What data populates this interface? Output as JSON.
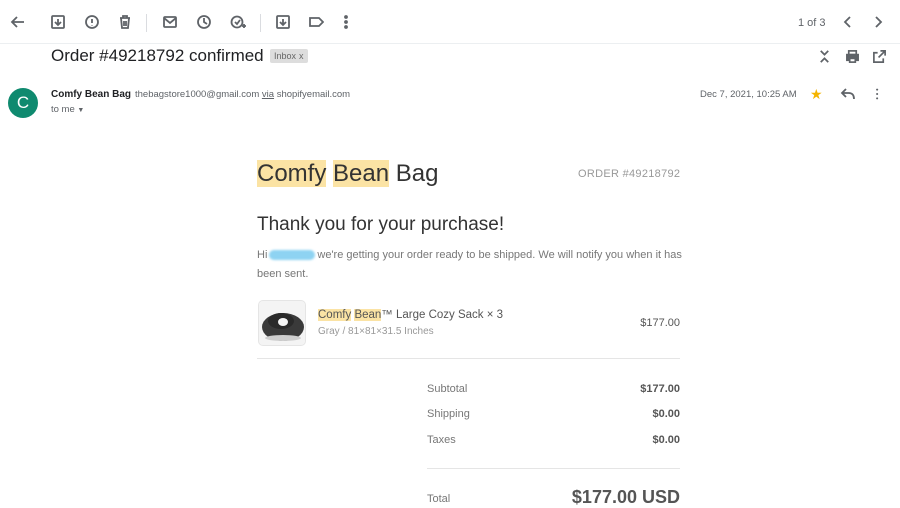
{
  "toolbar": {
    "icons": [
      "back-arrow-icon",
      "archive-icon",
      "report-spam-icon",
      "delete-icon",
      "mark-unread-icon",
      "snooze-icon",
      "add-task-icon",
      "move-to-icon",
      "label-icon",
      "more-vert-icon"
    ],
    "pager": "1 of 3"
  },
  "email": {
    "subject": "Order #49218792 confirmed",
    "label": "Inbox",
    "label_close": "x",
    "sender_initial": "C",
    "sender_name": "Comfy Bean Bag",
    "sender_email": "thebagstore1000@gmail.com",
    "via_text": "via",
    "via_domain": "shopifyemail.com",
    "to": "to me",
    "date": "Dec 7, 2021, 10:25 AM",
    "starred": true
  },
  "body": {
    "brand_part1": "Comfy",
    "brand_part2": "Bean",
    "brand_part3": "Bag",
    "order_number": "ORDER #49218792",
    "thanks": "Thank you for your purchase!",
    "message_prefix": "Hi",
    "message_rest": "we're getting your order ready to be shipped. We will notify you when it has been sent.",
    "product": {
      "name_part1": "Comfy",
      "name_part2": "Bean",
      "name_rest": "™ Large Cozy Sack × 3",
      "variant": "Gray / 81×81×31.5 Inches",
      "price": "$177.00"
    },
    "summary": [
      {
        "label": "Subtotal",
        "value": "$177.00"
      },
      {
        "label": "Shipping",
        "value": "$0.00"
      },
      {
        "label": "Taxes",
        "value": "$0.00"
      }
    ],
    "total_label": "Total",
    "total_value": "$177.00 USD"
  },
  "colors": {
    "avatar": "#0f8a6f",
    "highlight": "#fbe3a4",
    "star": "#f4b400"
  }
}
